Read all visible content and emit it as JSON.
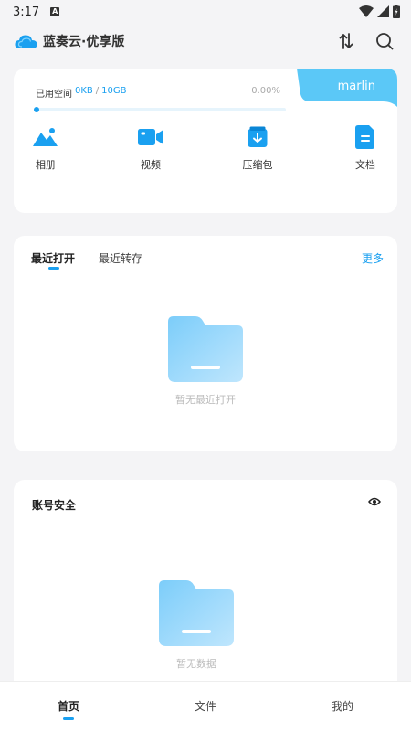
{
  "status_bar": {
    "time": "3:17",
    "badge": "A"
  },
  "header": {
    "app_title": "蓝奏云·优享版"
  },
  "storage": {
    "user_name": "marlin",
    "label": "已用空间",
    "used": "0KB",
    "separator": "/",
    "total": "10GB",
    "percent": "0.00%",
    "progress_fraction": 0.0
  },
  "categories": [
    {
      "label": "相册",
      "icon": "photo-icon"
    },
    {
      "label": "视频",
      "icon": "video-icon"
    },
    {
      "label": "压缩包",
      "icon": "archive-icon"
    },
    {
      "label": "文档",
      "icon": "document-icon"
    }
  ],
  "recent": {
    "tabs": [
      "最近打开",
      "最近转存"
    ],
    "more": "更多",
    "empty_text": "暂无最近打开"
  },
  "security": {
    "title": "账号安全",
    "empty_text": "暂无数据"
  },
  "bottom_nav": [
    "首页",
    "文件",
    "我的"
  ],
  "colors": {
    "accent": "#1aa0f0",
    "user_tab": "#5bc8f7",
    "folder": "#8fd4fb"
  }
}
